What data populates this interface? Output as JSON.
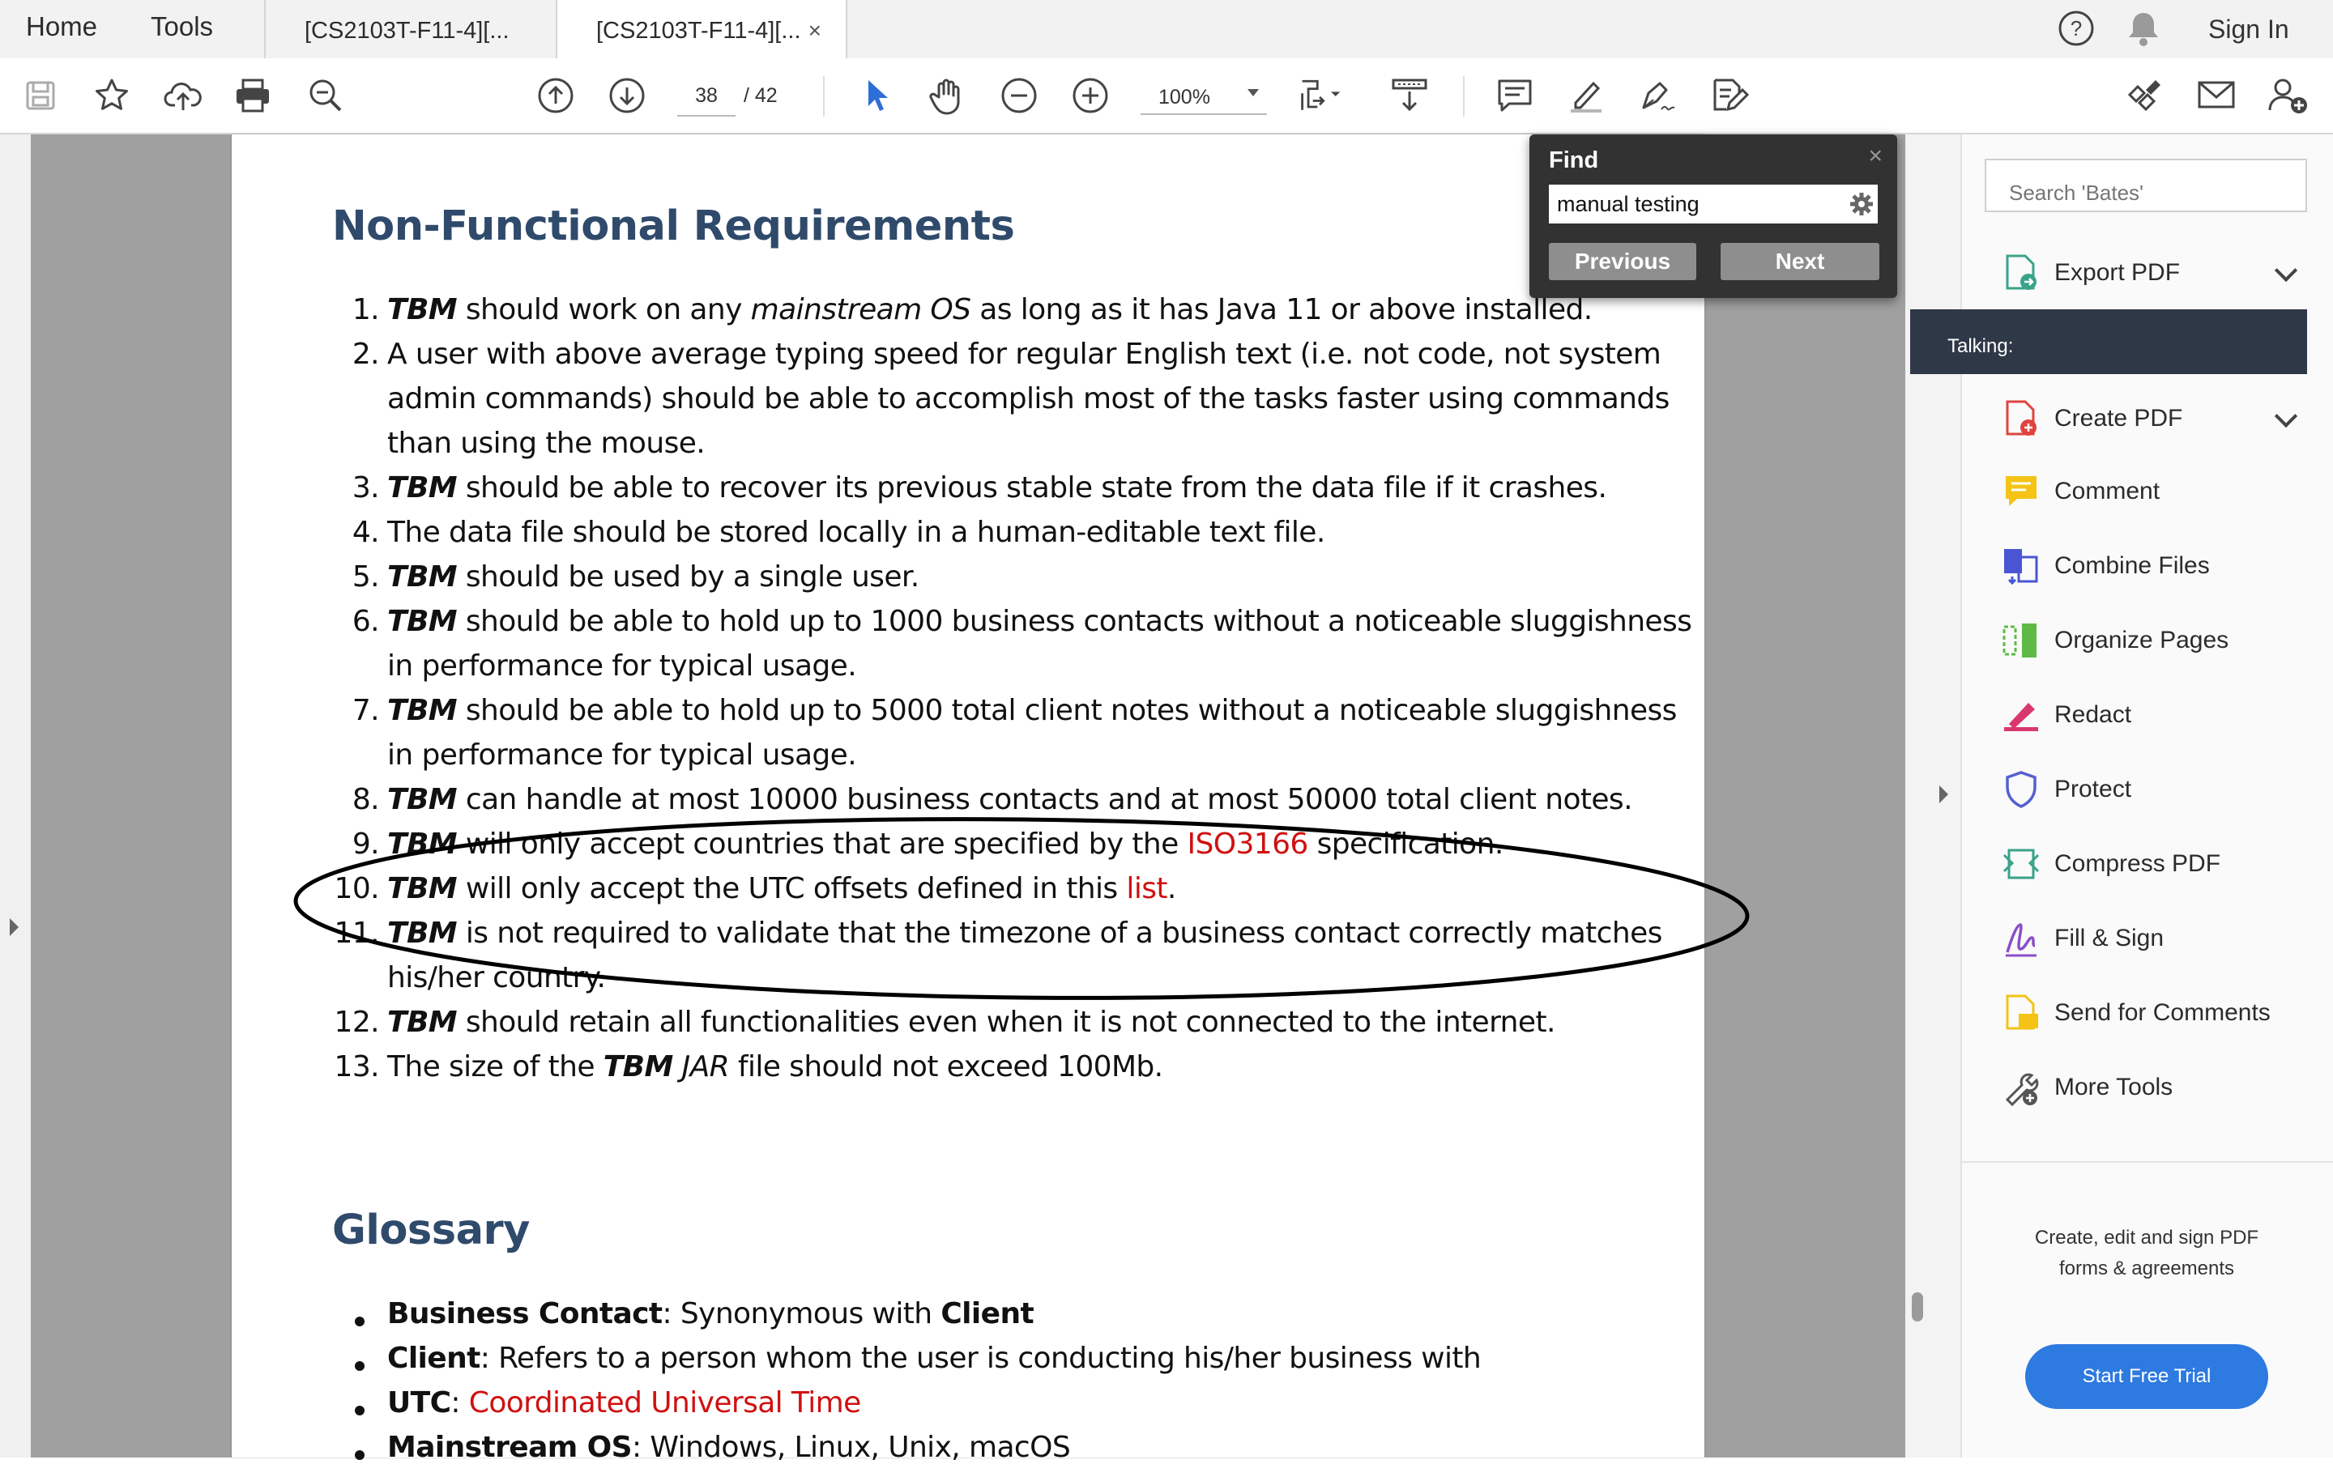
{
  "menu": {
    "home": "Home",
    "tools": "Tools"
  },
  "tabs": [
    {
      "label": "[CS2103T-F11-4][..."
    },
    {
      "label": "[CS2103T-F11-4][...",
      "close": "×"
    }
  ],
  "topright": {
    "sign_in": "Sign In"
  },
  "toolbar": {
    "page_current": "38",
    "page_total": "/  42",
    "zoom": "100%"
  },
  "find": {
    "title": "Find",
    "close": "×",
    "query": "manual testing",
    "prev_label": "Previous",
    "next_label": "Next"
  },
  "doc": {
    "heading1": "Non-Functional Requirements",
    "nfr": [
      {
        "n": "1.",
        "t1": "TBM",
        "t2": " should work on any ",
        "t3": "mainstream OS",
        "t4": " as long as it has Java 11 or above installed."
      },
      {
        "n": "2.",
        "line1": "A user with above average typing speed for regular English text (i.e. not code, not system",
        "line2": "admin commands) should be able to accomplish most of the tasks faster using commands",
        "line3": "than using the mouse."
      },
      {
        "n": "3.",
        "t1": "TBM",
        "t2": " should be able to recover its previous stable state from the data file if it crashes."
      },
      {
        "n": "4.",
        "line1": "The data file should be stored locally in a human-editable text file."
      },
      {
        "n": "5.",
        "t1": "TBM",
        "t2": " should be used by a single user."
      },
      {
        "n": "6.",
        "t1": "TBM",
        "t2": " should be able to hold up to 1000 business contacts without a noticeable sluggishness",
        "line2": "in performance for typical usage."
      },
      {
        "n": "7.",
        "t1": "TBM",
        "t2": " should be able to hold up to 5000 total client notes without a noticeable sluggishness",
        "line2": "in performance for typical usage."
      },
      {
        "n": "8.",
        "t1": "TBM",
        "t2": " can handle at most 10000 business contacts and at most 50000 total client notes."
      },
      {
        "n": "9.",
        "t1": "TBM",
        "t2": " will only accept countries that are specified by the ",
        "link": "ISO3166",
        "t3": " specification."
      },
      {
        "n": "10.",
        "t1": "TBM",
        "t2": " will only accept the UTC offsets defined in this ",
        "link": "list",
        "t3": "."
      },
      {
        "n": "11.",
        "t1": "TBM",
        "t2": " is not required to validate that the timezone of a business contact correctly matches",
        "line2": "his/her country."
      },
      {
        "n": "12.",
        "t1": "TBM",
        "t2": " should retain all functionalities even when it is not connected to the internet."
      },
      {
        "n": "13.",
        "t0": "The size of the ",
        "t1": "TBM",
        "t2": " JAR",
        "t3": " file should not exceed 100Mb."
      }
    ],
    "heading2": "Glossary",
    "glossary": [
      {
        "term": "Business Contact",
        "mid": ": Synonymous with ",
        "term2": "Client"
      },
      {
        "term": "Client",
        "mid": ": Refers to a person whom the user is conducting his/her business with"
      },
      {
        "term": "UTC",
        "mid": ": ",
        "link": "Coordinated Universal Time"
      },
      {
        "term": "Mainstream OS",
        "mid": ": Windows, Linux, Unix, macOS"
      }
    ]
  },
  "rpanel": {
    "search_placeholder": "Search 'Bates'",
    "talking": "Talking:",
    "tools": [
      {
        "label": "Export PDF",
        "color": "#3aa38a"
      },
      {
        "label": "Create PDF",
        "color": "#e0443e"
      },
      {
        "label": "Comment",
        "color": "#f4c316"
      },
      {
        "label": "Combine Files",
        "color": "#4a55d4"
      },
      {
        "label": "Organize Pages",
        "color": "#5fb946"
      },
      {
        "label": "Redact",
        "color": "#d8386f"
      },
      {
        "label": "Protect",
        "color": "#5560cf"
      },
      {
        "label": "Compress PDF",
        "color": "#3aa38a"
      },
      {
        "label": "Fill & Sign",
        "color": "#8a4fc8"
      },
      {
        "label": "Send for Comments",
        "color": "#f4c316"
      },
      {
        "label": "More Tools",
        "color": "#555555"
      }
    ],
    "promo_line1": "Create, edit and sign PDF",
    "promo_line2": "forms & agreements",
    "trial": "Start Free Trial"
  }
}
